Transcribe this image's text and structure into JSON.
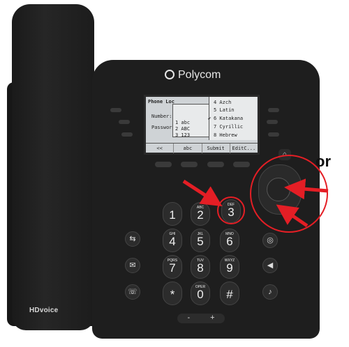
{
  "brand": {
    "logo_text": "Polycom",
    "hd_text": "HDvoice"
  },
  "screen": {
    "title": "Phone Loc",
    "labels": [
      "Number:",
      "Password:"
    ],
    "input_modes": [
      "1 abc",
      "2 ABC",
      "3 123"
    ],
    "languages": [
      "4 Azch",
      "5 Latin",
      "6 Katakana",
      "7 Cyrillic",
      "8 Hebrew"
    ],
    "checked_index": 2,
    "softkeys": [
      "<<",
      "abc",
      "Submit",
      "EditC..."
    ]
  },
  "keypad": [
    {
      "num": "1",
      "letters": ""
    },
    {
      "num": "2",
      "letters": "ABC"
    },
    {
      "num": "3",
      "letters": "DEF"
    },
    {
      "num": "4",
      "letters": "GHI"
    },
    {
      "num": "5",
      "letters": "JKL"
    },
    {
      "num": "6",
      "letters": "MNO"
    },
    {
      "num": "7",
      "letters": "PQRS"
    },
    {
      "num": "8",
      "letters": "TUV"
    },
    {
      "num": "9",
      "letters": "WXYZ"
    },
    {
      "num": "*",
      "letters": ""
    },
    {
      "num": "0",
      "letters": "OPER"
    },
    {
      "num": "#",
      "letters": ""
    }
  ],
  "volume": {
    "minus": "-",
    "plus": "+"
  },
  "annotation": {
    "or_text": "or",
    "color": "#e41e25"
  },
  "icons": [
    "home-icon",
    "headset-icon",
    "speaker-icon",
    "mute-icon",
    "transfer-icon",
    "message-icon",
    "redial-icon",
    "volume-icon"
  ]
}
